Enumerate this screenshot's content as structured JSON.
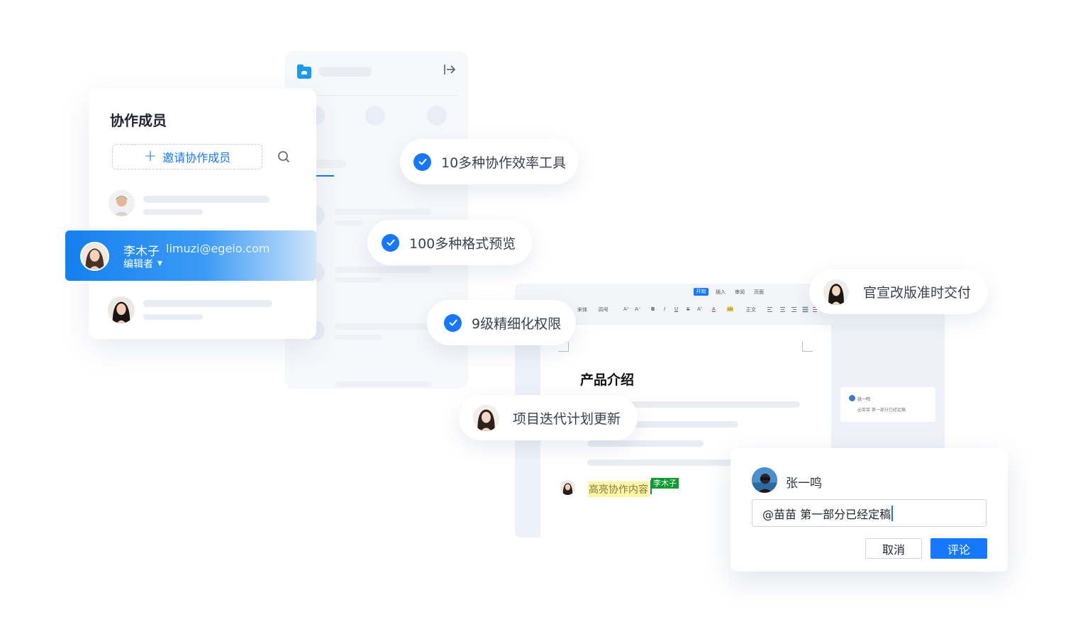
{
  "members_panel": {
    "title": "协作成员",
    "invite_label": "邀请协作成员",
    "selected_member": {
      "name": "李木子",
      "email": "limuzi@egeio.com",
      "role": "编辑者"
    }
  },
  "features": [
    {
      "label": "10多种协作效率工具",
      "icon": "check-circle-icon"
    },
    {
      "label": "100多种格式预览",
      "icon": "check-circle-icon"
    },
    {
      "label": "9级精细化权限",
      "icon": "check-circle-icon"
    }
  ],
  "activity": [
    {
      "label": "官宣改版准时交付"
    },
    {
      "label": "项目迭代计划更新"
    }
  ],
  "document": {
    "tabs": [
      "开始",
      "插入",
      "审阅",
      "页面"
    ],
    "toolbar": [
      "宋体",
      "四号",
      "A⁺",
      "A⁻",
      "B",
      "I",
      "U",
      "S",
      "A'",
      "A",
      "ab",
      "正文"
    ],
    "title": "产品介绍",
    "highlight_text": "高亮协作内容",
    "cursor_user": "李木子",
    "side_comment": {
      "name": "张一鸣",
      "text": "@苗苗 第一部分已经定稿"
    }
  },
  "comment_box": {
    "author": "张一鸣",
    "input_value": "@苗苗 第一部分已经定稿",
    "cancel_label": "取消",
    "submit_label": "评论"
  },
  "colors": {
    "accent": "#1677ff",
    "highlight": "#fff6a8",
    "cursor": "#0a9a2e"
  }
}
